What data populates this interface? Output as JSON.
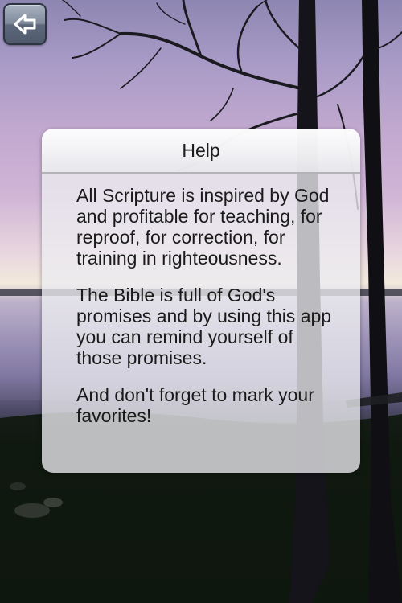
{
  "window": {
    "title": "Help"
  },
  "toolbar": {
    "back_icon": "back-arrow-icon"
  },
  "help": {
    "title": "Help",
    "paragraphs": [
      "All Scripture is inspired by God and profitable for teaching, for reproof, for correction, for training in righteousness.",
      "The Bible is full of God's promises and by using this app you can remind yourself of those promises.",
      "And don't forget to mark your favorites!"
    ]
  },
  "colors": {
    "panel_background": "#ececf0",
    "button_gradient_top": "#a9b3c1",
    "button_gradient_bottom": "#4f5a6c",
    "text": "#1a1a1a"
  }
}
